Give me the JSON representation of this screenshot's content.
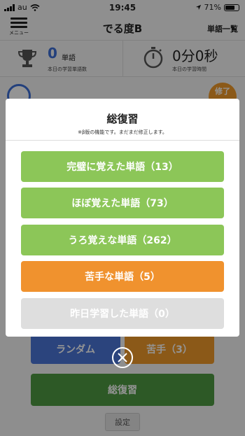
{
  "status_bar": {
    "carrier": "au",
    "time": "19:45",
    "battery": "71%",
    "battery_level": 0.71
  },
  "navbar": {
    "menu_label": "メニュー",
    "title": "でる度B",
    "right_link": "単語一覧"
  },
  "stats": {
    "words_count": "0",
    "words_unit": "単語",
    "words_sub": "本日の学習単語数",
    "time_value": "0分0秒",
    "time_sub": "本日の学習時間"
  },
  "background": {
    "complete_badge": "修了",
    "random_label": "ランダム",
    "weak_label": "苦手（3）",
    "review_label": "総復習",
    "settings_label": "設定"
  },
  "modal": {
    "title": "総復習",
    "note": "※β版の機能です。まだまだ修正します。",
    "buttons": [
      {
        "label": "完璧に覚えた単語（13）"
      },
      {
        "label": "ほぼ覚えた単語（73）"
      },
      {
        "label": "うろ覚えな単語（262）"
      },
      {
        "label": "苦手な単語（5）"
      },
      {
        "label": "昨日学習した単語（0）"
      }
    ]
  },
  "colors": {
    "green": "#8cc658",
    "orange": "#f0922e",
    "gray": "#dedede",
    "blue": "#4a75d8",
    "dark_green": "#4f9a43"
  },
  "icons": [
    "signal-icon",
    "wifi-icon",
    "location-icon",
    "battery-icon",
    "menu-icon",
    "trophy-icon",
    "stopwatch-icon",
    "close-icon"
  ]
}
